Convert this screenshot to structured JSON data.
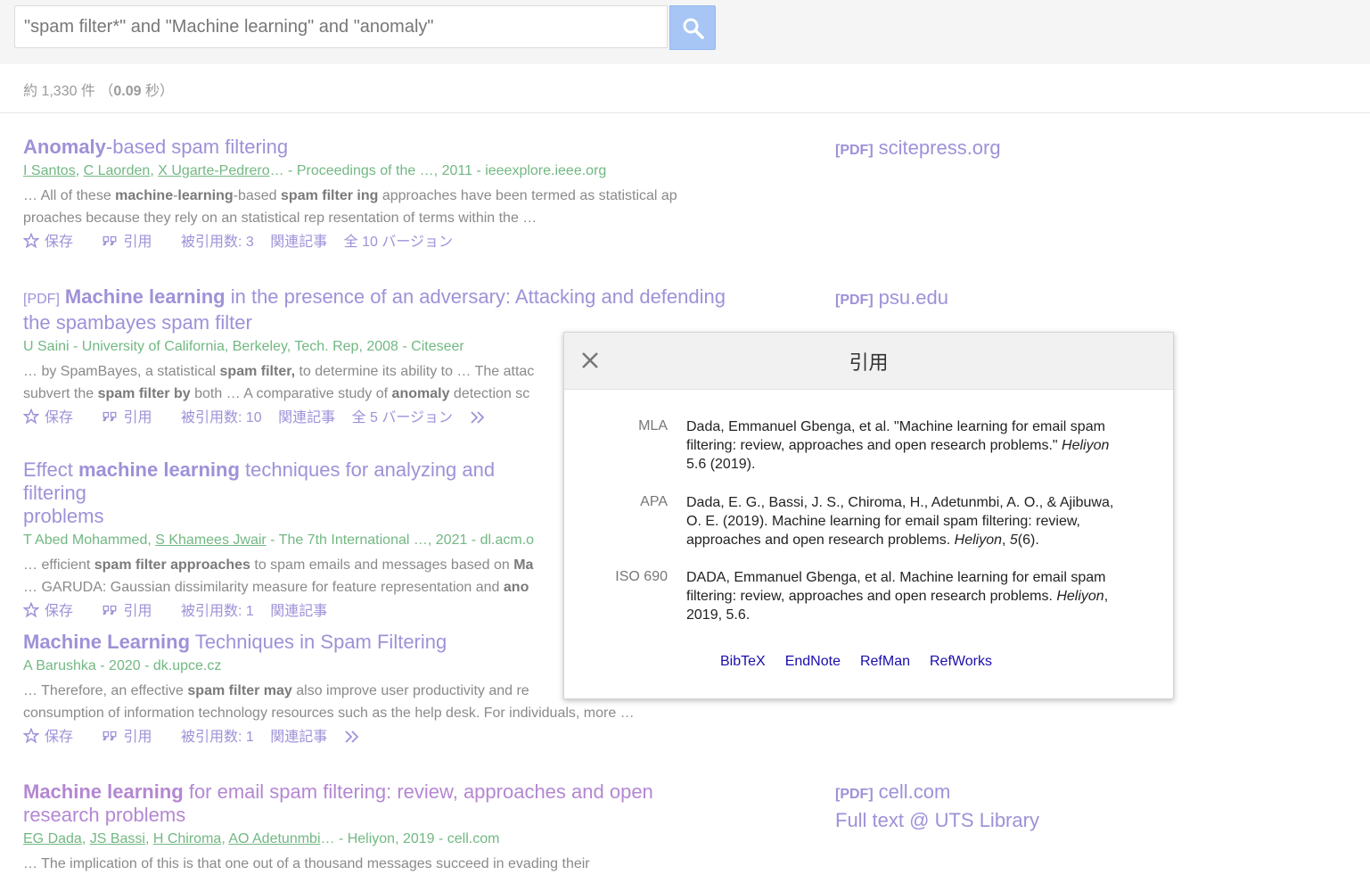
{
  "search": {
    "query": "\"spam filter*\" and \"Machine learning\" and \"anomaly\""
  },
  "stats": {
    "prefix": "約 1,330 件 （",
    "time": "0.09",
    "suffix": " 秒）"
  },
  "results": [
    {
      "title_b1": "Anomaly",
      "title_t1": "-based spam filtering",
      "authors": [
        "I Santos",
        "C Laorden",
        "X Ugarte-Pedrero"
      ],
      "source": "… - Proceedings of the …, 2011 - ieeexplore.ieee.org",
      "snippet": "… All of these <b>machine</b>-<b>learning</b>-based <b>spam filter ing</b> approaches have been termed as statistical ap proaches because they rely on an statistical rep resentation of terms within the …",
      "actions": {
        "save": "保存",
        "cite": "引用",
        "cited_by": "被引用数: 3",
        "related": "関連記事",
        "versions": "全 10 バージョン"
      },
      "side": {
        "tag": "[PDF]",
        "label": "scitepress.org"
      }
    },
    {
      "tag": "[PDF]",
      "title_b1": "Machine learning",
      "title_t1": " in the presence of an adversary: Attacking and defending the spambayes spam filter",
      "source": "U Saini - University of California, Berkeley, Tech. Rep, 2008 - Citeseer",
      "snippet": "… by SpamBayes, a statistical <b>spam filter,</b> to determine its ability to … The attac<br>subvert the <b>spam filter by</b> both … A comparative study of <b>anomaly</b> detection sc",
      "actions": {
        "save": "保存",
        "cite": "引用",
        "cited_by": "被引用数: 10",
        "related": "関連記事",
        "versions": "全 5 バージョン"
      },
      "side": {
        "tag": "[PDF]",
        "label": "psu.edu"
      }
    },
    {
      "title_t0": "Effect ",
      "title_b1": "machine learning",
      "title_t1": " techniques for analyzing and filtering<br>problems",
      "authors_plain": "T Abed Mohammed, ",
      "authors": [
        "S Khamees Jwair"
      ],
      "source": " - The 7th International …, 2021 - dl.acm.o",
      "snippet": "… efficient <b>spam filter approaches</b> to spam emails and messages based on <b>Ma</b><br>… GARUDA: Gaussian dissimilarity measure for feature representation and <b>ano</b>",
      "actions": {
        "save": "保存",
        "cite": "引用",
        "cited_by": "被引用数: 1",
        "related": "関連記事"
      }
    },
    {
      "title_b1": "Machine Learning",
      "title_t1": " Techniques in Spam Filtering",
      "source": "A Barushka - 2020 - dk.upce.cz",
      "snippet": "… Therefore, an effective <b>spam filter may</b> also improve user productivity and re<br>consumption of information technology resources such as the help desk. For individuals, more …",
      "actions": {
        "save": "保存",
        "cite": "引用",
        "cited_by": "被引用数: 1",
        "related": "関連記事"
      }
    },
    {
      "title_b1": "Machine learning",
      "title_t1": " for email spam filtering: review, approaches and open research problems",
      "authors": [
        "EG Dada",
        "JS Bassi",
        "H Chiroma",
        "AO Adetunmbi"
      ],
      "source": "… - Heliyon, 2019 - cell.com",
      "snippet": "… The implication of this is that one out of a thousand messages succeed in evading their",
      "side": {
        "tag": "[PDF]",
        "label": "cell.com",
        "extra": "Full text @ UTS Library"
      }
    }
  ],
  "modal": {
    "title": "引用",
    "citations": [
      {
        "style": "MLA",
        "text": "Dada, Emmanuel Gbenga, et al. \"Machine learning for email spam filtering: review, approaches and open research problems.\" <i>Heliyon</i> 5.6 (2019)."
      },
      {
        "style": "APA",
        "text": "Dada, E. G., Bassi, J. S., Chiroma, H., Adetunmbi, A. O., &amp; Ajibuwa, O. E. (2019). Machine learning for email spam filtering: review, approaches and open research problems. <i>Heliyon</i>, <i>5</i>(6)."
      },
      {
        "style": "ISO 690",
        "text": "DADA, Emmanuel Gbenga, et al. Machine learning for email spam filtering: review, approaches and open research problems. <i>Heliyon</i>, 2019, 5.6."
      }
    ],
    "exports": [
      "BibTeX",
      "EndNote",
      "RefMan",
      "RefWorks"
    ]
  }
}
